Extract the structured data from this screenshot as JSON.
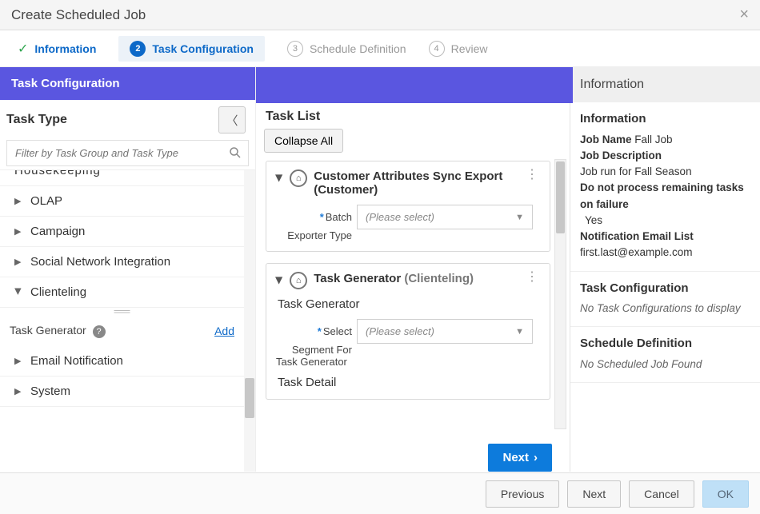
{
  "dialog_title": "Create Scheduled Job",
  "steps": [
    {
      "label": "Information",
      "state": "done"
    },
    {
      "label": "Task Configuration",
      "state": "active",
      "num": "2"
    },
    {
      "label": "Schedule Definition",
      "state": "future",
      "num": "3"
    },
    {
      "label": "Review",
      "state": "future",
      "num": "4"
    }
  ],
  "banner": "Task Configuration",
  "task_type": {
    "header": "Task Type",
    "filter_placeholder": "Filter by Task Group and Task Type",
    "partial_top": "Housekeeping",
    "groups": [
      {
        "label": "OLAP",
        "expanded": false
      },
      {
        "label": "Campaign",
        "expanded": false
      },
      {
        "label": "Social Network Integration",
        "expanded": false
      },
      {
        "label": "Clienteling",
        "expanded": true
      },
      {
        "label": "Email Notification",
        "expanded": false
      },
      {
        "label": "System",
        "expanded": false
      }
    ],
    "clienteling_child": "Task Generator",
    "add_link": "Add"
  },
  "task_list": {
    "header": "Task List",
    "collapse_all": "Collapse All",
    "cards": [
      {
        "title": "Customer Attributes Sync Export",
        "paren": "(Customer)",
        "field_label": "Batch Exporter Type",
        "field_short": "Batch",
        "field_short2": "Exporter Type",
        "placeholder": "(Please select)"
      },
      {
        "title": "Task Generator",
        "paren": "(Clienteling)",
        "section_label": "Task Generator",
        "field_label_line1": "Select",
        "field_label_line2": "Segment For",
        "field_label_line3": "Task Generator",
        "placeholder": "(Please select)",
        "detail_label": "Task Detail"
      }
    ],
    "next": "Next"
  },
  "info_panel": {
    "header": "Information",
    "section1_title": "Information",
    "job_name_k": "Job Name",
    "job_name_v": "Fall Job",
    "job_desc_k": "Job Description",
    "job_desc_v": "Job run for Fall Season",
    "halt_k": "Do not process remaining tasks on failure",
    "halt_v": "Yes",
    "email_k": "Notification Email List",
    "email_v": "first.last@example.com",
    "section2_title": "Task Configuration",
    "section2_body": "No Task Configurations to display",
    "section3_title": "Schedule Definition",
    "section3_body": "No Scheduled Job Found"
  },
  "footer": {
    "previous": "Previous",
    "next": "Next",
    "cancel": "Cancel",
    "ok": "OK"
  }
}
